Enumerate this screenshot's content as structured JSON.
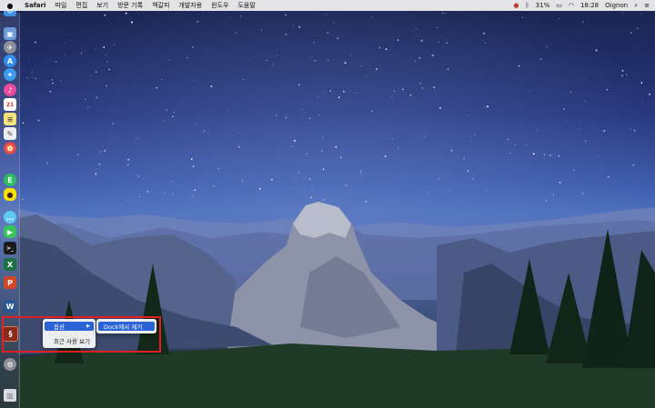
{
  "menubar": {
    "apple_icon": "apple-logo-icon",
    "app_name": "Safari",
    "menus": [
      "파일",
      "편집",
      "보기",
      "방문 기록",
      "책갈피",
      "개발자용",
      "윈도우",
      "도움말"
    ],
    "battery_percent": "31%",
    "time": "18:28",
    "user": "Oignon"
  },
  "dock": {
    "icons": [
      "finder-icon",
      "photo-preview-icon",
      "launchpad-icon",
      "app-store-icon",
      "safari-icon",
      "itunes-icon",
      "calendar-icon",
      "notes-icon",
      "textedit-icon",
      "photos-icon",
      "evernote-icon",
      "kakaotalk-icon",
      "messages-icon",
      "facetime-icon",
      "terminal-icon",
      "excel-icon",
      "powerpoint-icon",
      "word-icon",
      "highlighted-app-icon",
      "system-preferences-icon",
      "trash-icon"
    ]
  },
  "context_menu": {
    "items": [
      {
        "label": "옵션",
        "has_submenu": true,
        "active": true
      },
      {
        "label": "최근 사용 보기",
        "has_submenu": false,
        "active": false
      }
    ],
    "submenu": {
      "items": [
        {
          "label": "Dock에서 제거",
          "active": true
        }
      ]
    }
  },
  "colors": {
    "menubar": "#ececec",
    "highlight_box": "#e02020",
    "menu_selection": "#2a63d6"
  }
}
